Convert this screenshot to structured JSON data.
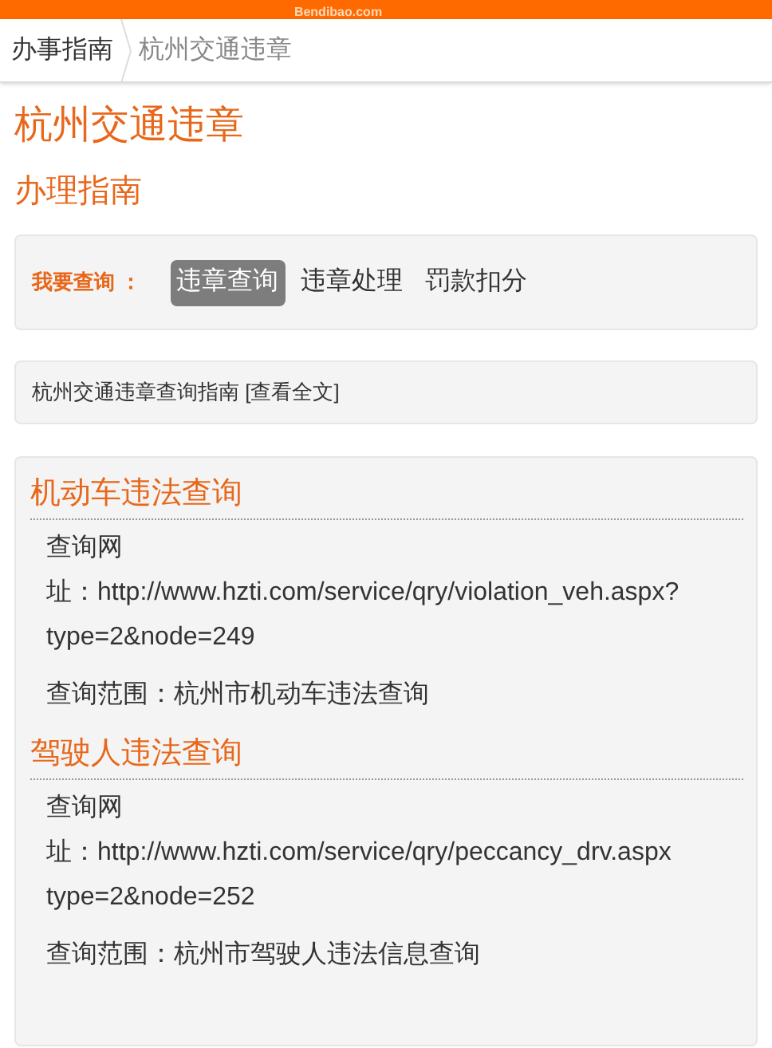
{
  "top_bar": {
    "logo": "Bendibao.com"
  },
  "breadcrumb": [
    {
      "label": "办事指南",
      "selected": false
    },
    {
      "label": "杭州交通违章",
      "selected": true
    }
  ],
  "title": "杭州交通违章",
  "subtitle": "办理指南",
  "query": {
    "label": "我要查询 ：",
    "tabs": [
      {
        "label": "违章查询",
        "selected": true
      },
      {
        "label": "违章处理",
        "selected": false
      },
      {
        "label": "罚款扣分",
        "selected": false
      }
    ]
  },
  "guide": {
    "text": "杭州交通违章查询指南",
    "link": "[查看全文]"
  },
  "sections": [
    {
      "heading": "机动车违法查询",
      "address_lines": [
        "查询网",
        "址：http://www.hzti.com/service/qry/violation_veh.aspx?",
        "type=2&node=249"
      ],
      "scope": "查询范围：杭州市机动车违法查询"
    },
    {
      "heading": "驾驶人违法查询",
      "address_lines": [
        "查询网",
        "址：http://www.hzti.com/service/qry/peccancy_drv.aspx",
        "type=2&node=252"
      ],
      "scope": "查询范围：杭州市驾驶人违法信息查询"
    }
  ]
}
